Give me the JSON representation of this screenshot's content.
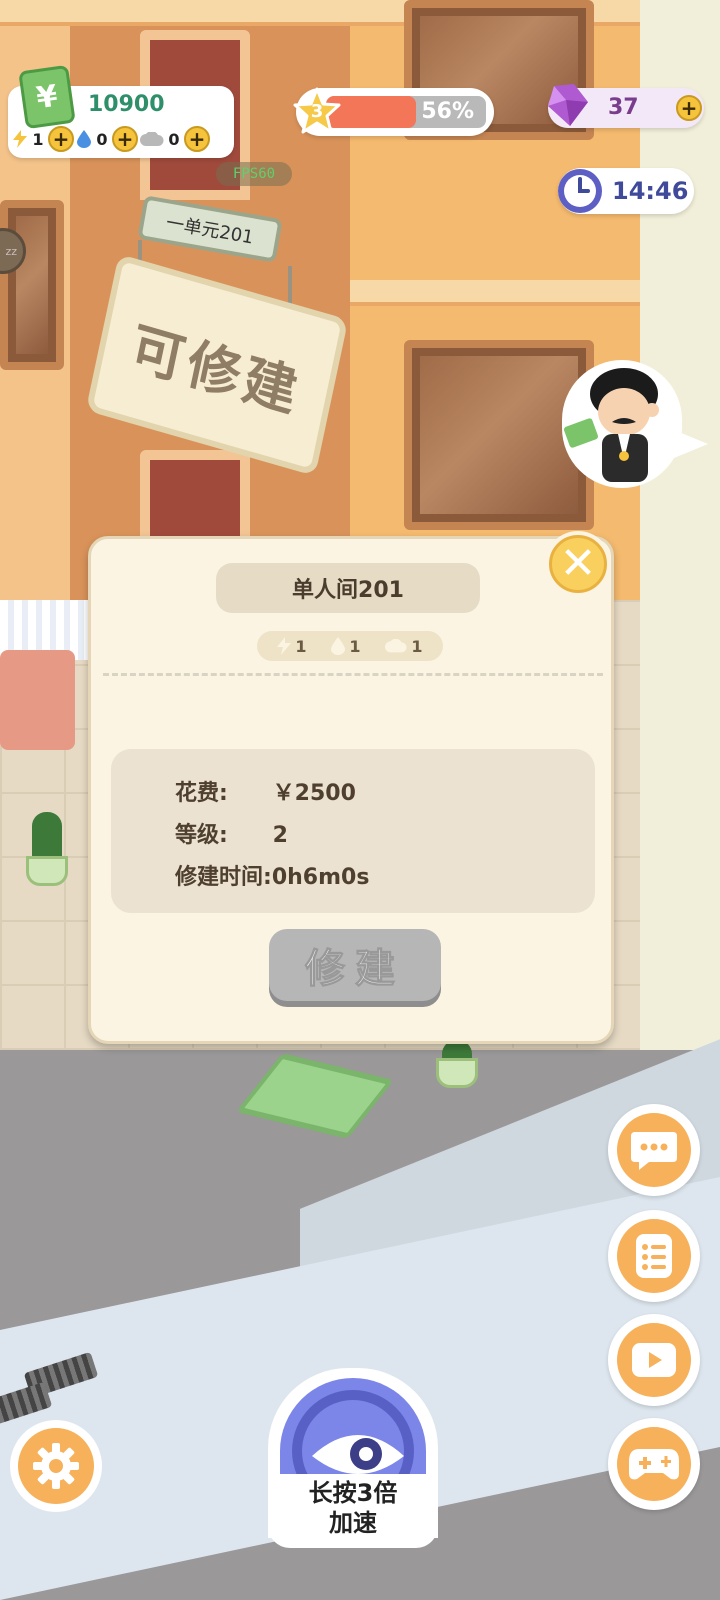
{
  "hud": {
    "money": "10900",
    "money_symbol": "¥",
    "resources": [
      {
        "icon": "energy-icon",
        "value": "1"
      },
      {
        "icon": "water-drop-icon",
        "value": "0"
      },
      {
        "icon": "cloud-icon",
        "value": "0"
      }
    ],
    "plus_label": "+",
    "fps": "FPS60",
    "level": "3",
    "progress_text": "56%",
    "progress_fraction": 0.56,
    "gems": "37",
    "time": "14:46"
  },
  "scene": {
    "unit_sign": "一单元201",
    "hanging_sign": "可修建"
  },
  "dialog": {
    "title": "单人间201",
    "cost_items": [
      {
        "icon": "energy-icon",
        "value": "1"
      },
      {
        "icon": "water-drop-icon",
        "value": "1"
      },
      {
        "icon": "cloud-icon",
        "value": "1"
      }
    ],
    "cost_label": "花费:",
    "cost_value": "￥2500",
    "level_label": "等级:",
    "level_value": "2",
    "time_label": "修建时间:",
    "time_value": "0h6m0s",
    "build_button": "修建",
    "close_icon": "close-icon"
  },
  "side_buttons": [
    "chat-icon",
    "task-list-icon",
    "video-play-icon",
    "gamepad-icon"
  ],
  "settings_icon": "gear-icon",
  "speed_up": {
    "label_line1": "长按3倍",
    "label_line2": "加速"
  },
  "colors": {
    "accent_orange": "#f6b15a",
    "money_green": "#2f8f6a",
    "progress_red": "#f27657",
    "gem_purple": "#7a3d8e",
    "clock_blue": "#3f4a9a",
    "speed_blue": "#7b86e8"
  }
}
